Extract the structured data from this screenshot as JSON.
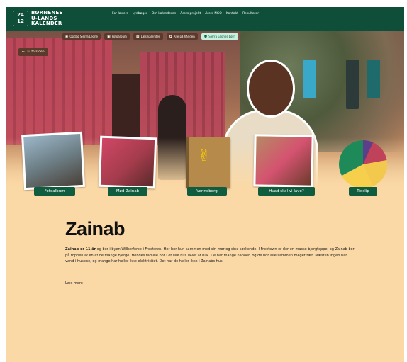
{
  "header": {
    "logo_mark": "24 12",
    "logo_lines": [
      "BØRNENES",
      "U-LANDS",
      "KALENDER"
    ],
    "nav": [
      "For lærere",
      "Lydbøger",
      "Om kalenderen",
      "Årets projekt",
      "Årets NGO",
      "Kontakt",
      "Resultater"
    ]
  },
  "actions": [
    {
      "icon": "eye-icon",
      "glyph": "◉",
      "label": "Opdag Sierra Leone"
    },
    {
      "icon": "camera-icon",
      "glyph": "▣",
      "label": "Fotoalbum"
    },
    {
      "icon": "grid-icon",
      "glyph": "▦",
      "label": "Læs kalender"
    },
    {
      "icon": "gear-icon",
      "glyph": "✿",
      "label": "Alle på hånden"
    },
    {
      "icon": "children-icon",
      "glyph": "⚉",
      "label": "Sierra Leones børn"
    }
  ],
  "back_label": "Til forsiden",
  "cards": [
    {
      "label": "Fotoalbum"
    },
    {
      "label": "Mød Zainab"
    },
    {
      "label": "Venneborg"
    },
    {
      "label": "Hvad skal vi lave?"
    },
    {
      "label": "Tidslip"
    }
  ],
  "main": {
    "title": "Zainab",
    "bio_lead": "Zainab er 11 år",
    "bio_text": " og bor i byen Wilberforce i Freetown. Her bor hun sammen med sin mor og sine søskende. I Freetown er der en masse bjergtoppe, og Zainab bor på toppen af en af de mange bjerge. Hendes familie bor i et lille hus lavet af blik. De har mange naboer, og de bor alle sammen meget tæt. Næsten ingen har vand i husene, og mange har heller ikke elektricitet. Det har de heller ikke i Zainabs hus.",
    "read_more": "Læs mere"
  },
  "colors": {
    "brand_green": "#0f4f3a",
    "peach": "#fbd9a6"
  }
}
